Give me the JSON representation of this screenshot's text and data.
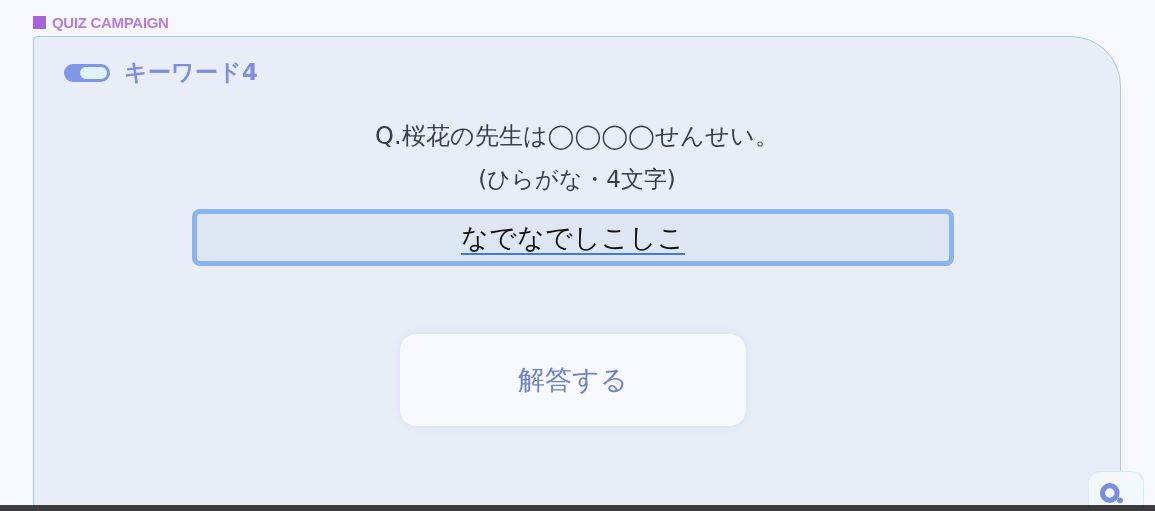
{
  "section_label": "QUIZ CAMPAIGN",
  "card": {
    "title": "キーワード4",
    "question": "Q.桜花の先生は◯◯◯◯せんせい。",
    "hint": "(ひらがな・4文字)",
    "answer": {
      "value": "なでなでしこしこ"
    },
    "submit": "解答する"
  }
}
